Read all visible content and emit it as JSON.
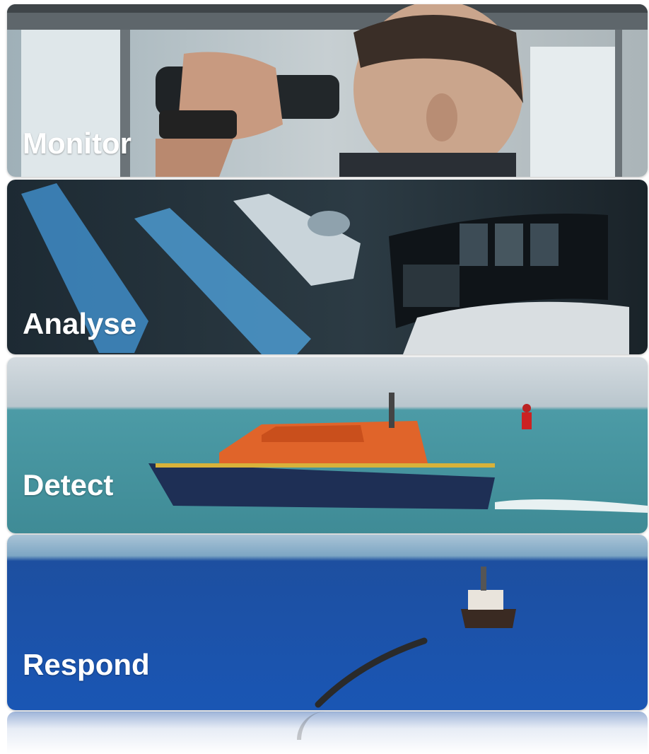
{
  "panels": [
    {
      "label": "Monitor",
      "scene": "officer-with-binoculars"
    },
    {
      "label": "Analyse",
      "scene": "digital-twin-ships-and-control-room"
    },
    {
      "label": "Detect",
      "scene": "lifeboat-at-sea"
    },
    {
      "label": "Respond",
      "scene": "vessel-with-oil-boom"
    }
  ]
}
